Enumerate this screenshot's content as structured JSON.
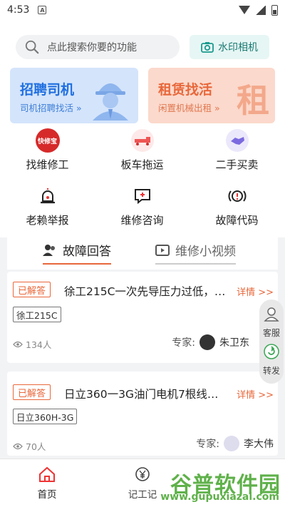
{
  "status_bar": {
    "time": "4:53",
    "notif_letter": "A"
  },
  "search": {
    "placeholder": "点此搜索你要的功能"
  },
  "watermark_camera": {
    "label": "水印相机"
  },
  "banners": [
    {
      "title": "招聘司机",
      "subtitle": "司机招聘找活 »"
    },
    {
      "title": "租赁找活",
      "subtitle": "闲置机械出租 »",
      "big_char": "租"
    }
  ],
  "quick_icons": [
    {
      "label": "找维修工",
      "icon": "kuaixiubao-logo-icon",
      "icon_text": "快修宝"
    },
    {
      "label": "板车拖运",
      "icon": "tow-truck-icon"
    },
    {
      "label": "二手买卖",
      "icon": "handshake-icon"
    },
    {
      "label": "老赖举报",
      "icon": "alarm-light-icon"
    },
    {
      "label": "维修咨询",
      "icon": "chat-plus-icon"
    },
    {
      "label": "故障代码",
      "icon": "warning-circle-icon"
    }
  ],
  "tabs": [
    {
      "label": "故障回答",
      "active": true,
      "icon": "users-icon"
    },
    {
      "label": "维修小视频",
      "active": false,
      "icon": "video-icon"
    }
  ],
  "questions": [
    {
      "badge": "已解答",
      "title": "徐工215C一次先导压力过低，…",
      "detail_link": "详情 >>",
      "tag": "徐工215C",
      "views": "134人",
      "expert_label": "专家:",
      "expert_name": "朱卫东"
    },
    {
      "badge": "已解答",
      "title": "日立360一3G油门电机7根线…",
      "detail_link": "详情 >>",
      "tag": "日立360H-3G",
      "views": "70人",
      "expert_label": "专家:",
      "expert_name": "李大伟"
    }
  ],
  "floating": {
    "service": "客服",
    "share": "转发"
  },
  "bottom_nav": [
    {
      "label": "首页",
      "icon": "home-icon",
      "active": true
    },
    {
      "label": "记工记",
      "icon": "yen-circle-icon",
      "active": false
    }
  ],
  "site_watermark": {
    "title": "谷普软件园",
    "url": "www.gupuxiazai.com"
  },
  "colors": {
    "accent": "#e8673a",
    "blue": "#1f6fe0",
    "teal": "#1a7a72",
    "tab_underline": "#e8673a"
  }
}
